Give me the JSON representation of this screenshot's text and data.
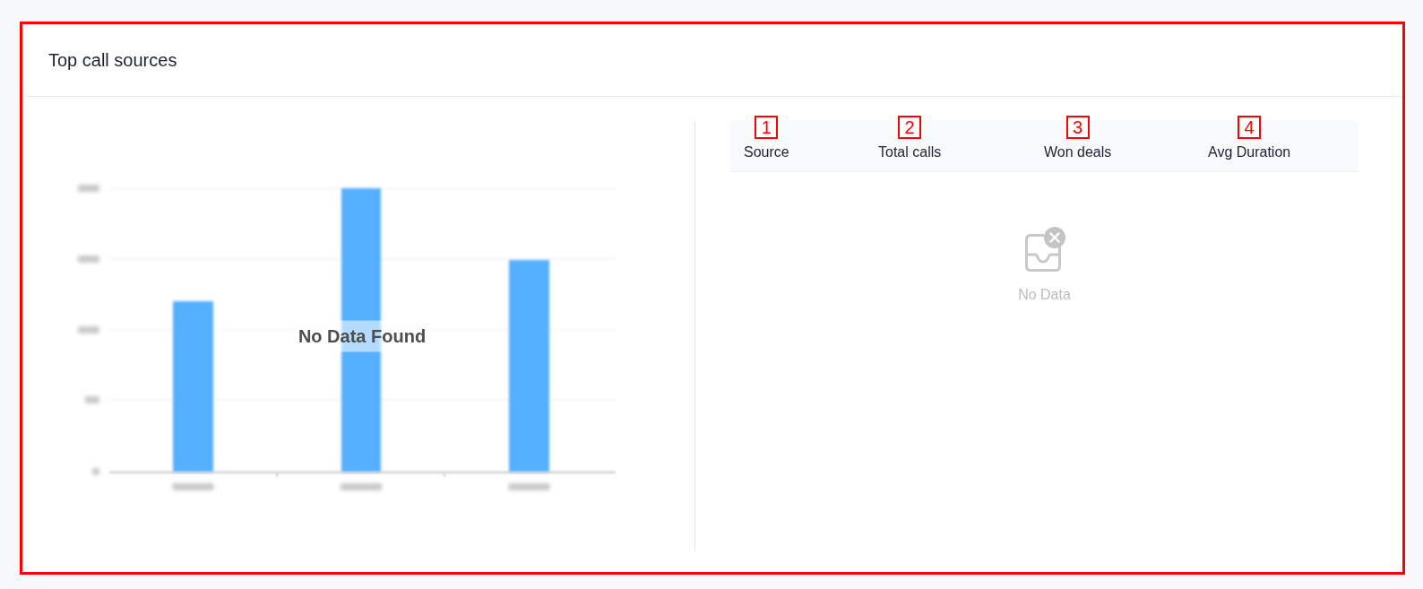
{
  "card": {
    "title": "Top call sources",
    "highlighted": true
  },
  "chart_panel": {
    "message": "No Data Found"
  },
  "table": {
    "columns": [
      {
        "label": "Source",
        "marker": "1"
      },
      {
        "label": "Total calls",
        "marker": "2"
      },
      {
        "label": "Won deals",
        "marker": "3"
      },
      {
        "label": "Avg Duration",
        "marker": "4"
      }
    ],
    "empty_message": "No Data"
  }
}
